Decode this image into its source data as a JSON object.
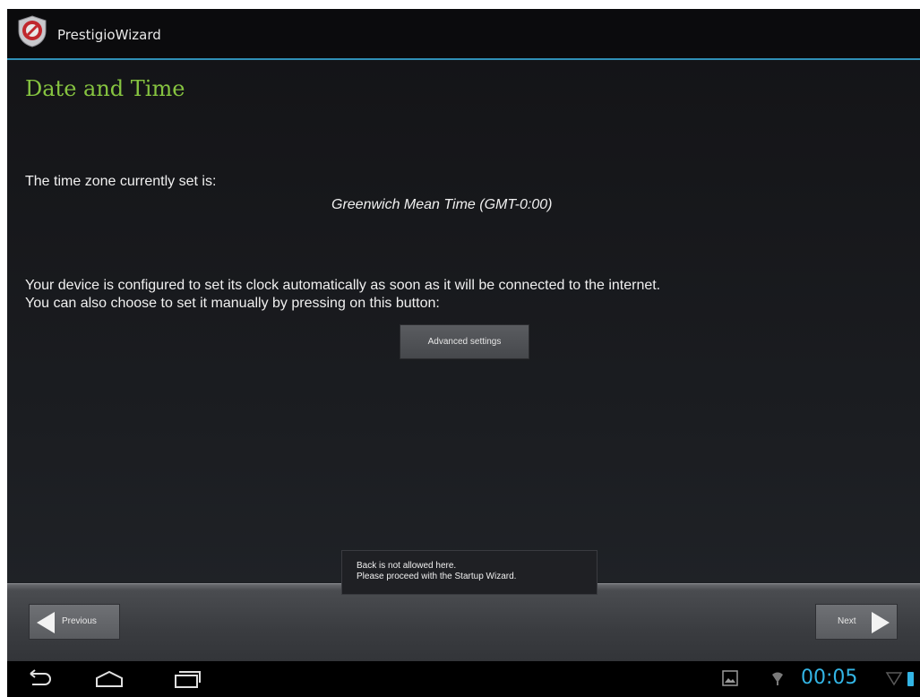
{
  "app": {
    "title": "PrestigioWizard",
    "accent": "#2f8fb6"
  },
  "page": {
    "title": "Date and Time",
    "title_color": "#86c440"
  },
  "timezone": {
    "label": "The time zone currently set is:",
    "value": "Greenwich Mean Time (GMT-0:00)"
  },
  "clock_info": {
    "line1": "Your device is configured to set its clock automatically as soon as it will be connected to the internet.",
    "line2": "You can also choose to set it manually by pressing on this button:"
  },
  "buttons": {
    "advanced": "Advanced settings",
    "previous": "Previous",
    "next": "Next"
  },
  "toast": {
    "line1": "Back is not allowed here.",
    "line2": "Please proceed with the Startup Wizard."
  },
  "system_bar": {
    "clock": "00:05",
    "clock_color": "#33b5e5",
    "icons": [
      "back-icon",
      "home-icon",
      "recent-apps-icon",
      "gallery-notification-icon",
      "wifi-icon",
      "signal-icon",
      "battery-icon"
    ]
  }
}
